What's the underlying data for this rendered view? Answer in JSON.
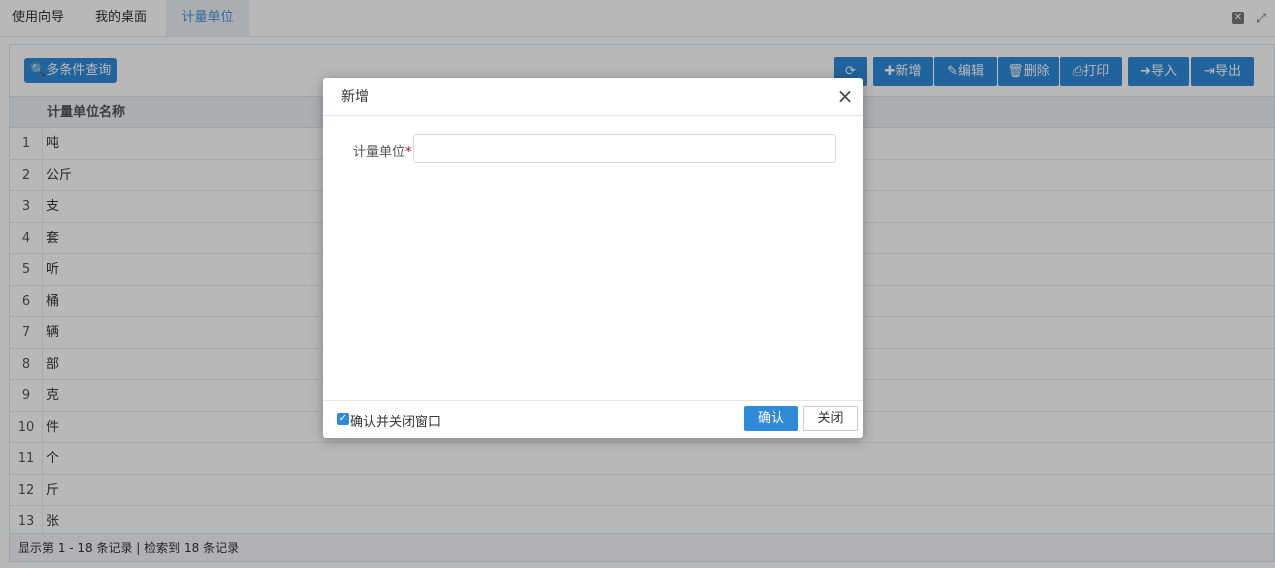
{
  "tabs": [
    {
      "label": "使用向导"
    },
    {
      "label": "我的桌面"
    },
    {
      "label": "计量单位"
    }
  ],
  "toolbar": {
    "query_label": "多条件查询",
    "add_label": "新增",
    "edit_label": "编辑",
    "delete_label": "删除",
    "print_label": "打印",
    "import_label": "导入",
    "export_label": "导出"
  },
  "grid": {
    "column_header": "计量单位名称",
    "rows": [
      {
        "num": "1",
        "name": "吨"
      },
      {
        "num": "2",
        "name": "公斤"
      },
      {
        "num": "3",
        "name": "支"
      },
      {
        "num": "4",
        "name": "套"
      },
      {
        "num": "5",
        "name": "听"
      },
      {
        "num": "6",
        "name": "桶"
      },
      {
        "num": "7",
        "name": "辆"
      },
      {
        "num": "8",
        "name": "部"
      },
      {
        "num": "9",
        "name": "克"
      },
      {
        "num": "10",
        "name": "件"
      },
      {
        "num": "11",
        "name": "个"
      },
      {
        "num": "12",
        "name": "斤"
      },
      {
        "num": "13",
        "name": "张"
      }
    ],
    "footer": "显示第 1 - 18 条记录 | 检索到 18 条记录"
  },
  "dialog": {
    "title": "新增",
    "field_label": "计量单位",
    "required_mark": "*",
    "field_value": "",
    "checkbox_label": "确认并关闭窗口",
    "checkbox_checked": true,
    "ok_label": "确认",
    "cancel_label": "关闭"
  },
  "colors": {
    "accent": "#2f8ad8",
    "active_tab_text": "#4a90e2",
    "required": "#d9001b"
  }
}
